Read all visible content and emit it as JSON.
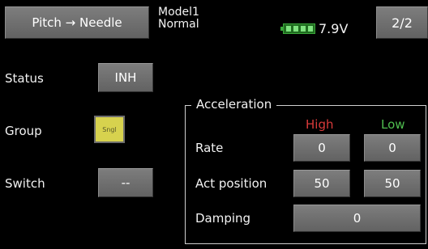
{
  "header": {
    "title": "Pitch → Needle",
    "model_name": "Model1",
    "condition": "Normal",
    "battery_voltage": "7.9V",
    "page_indicator": "2/2"
  },
  "settings": {
    "status_label": "Status",
    "status_value": "INH",
    "group_label": "Group",
    "group_value": "Sngl",
    "switch_label": "Switch",
    "switch_value": "--"
  },
  "acceleration": {
    "title": "Acceleration",
    "high_label": "High",
    "low_label": "Low",
    "rate_label": "Rate",
    "rate_high": "0",
    "rate_low": "0",
    "act_position_label": "Act position",
    "act_position_high": "50",
    "act_position_low": "50",
    "damping_label": "Damping",
    "damping_value": "0"
  },
  "colors": {
    "high": "#d83a3a",
    "low": "#4fbe4f",
    "battery": "#3aa83a"
  },
  "icons": {
    "battery": "battery-icon",
    "group": "group-single-icon"
  }
}
